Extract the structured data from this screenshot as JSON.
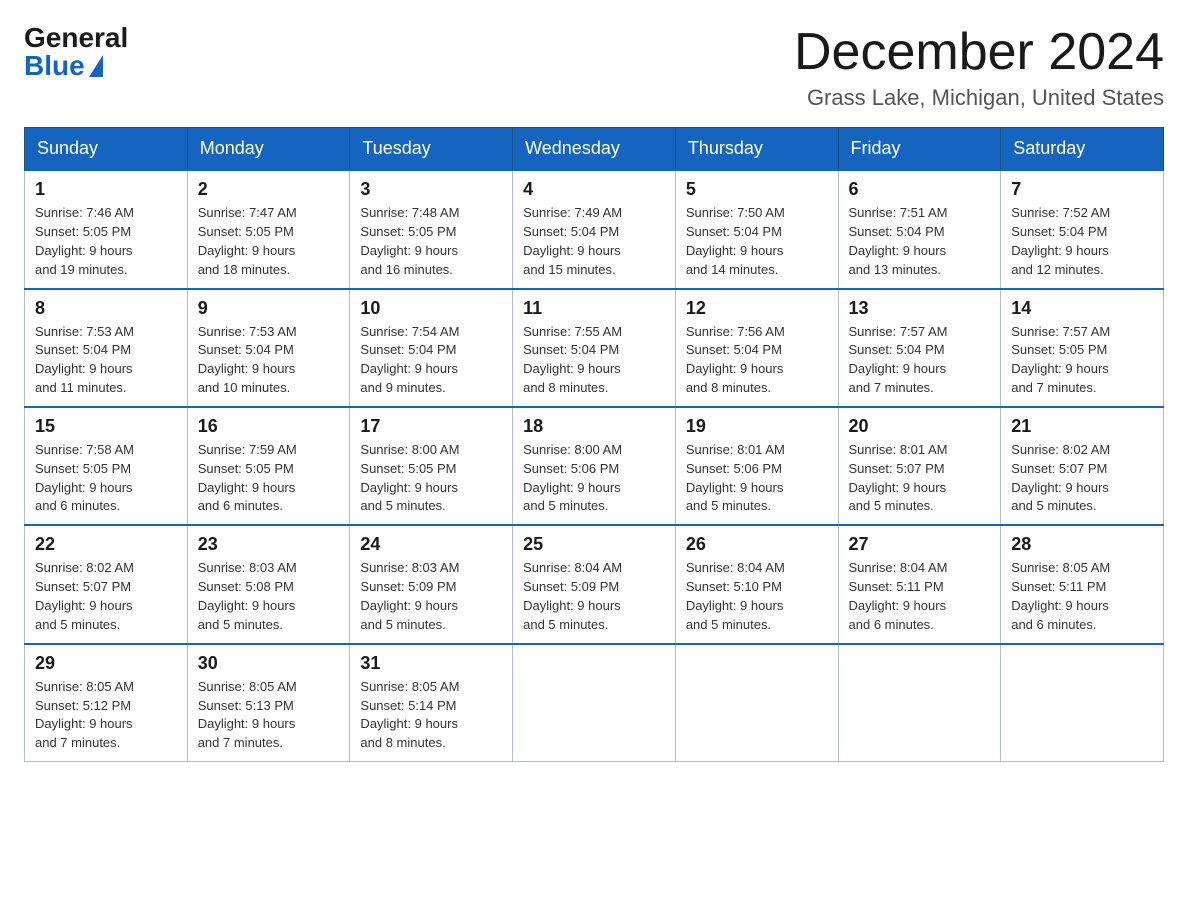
{
  "header": {
    "logo_general": "General",
    "logo_blue": "Blue",
    "month_title": "December 2024",
    "location": "Grass Lake, Michigan, United States"
  },
  "days_of_week": [
    "Sunday",
    "Monday",
    "Tuesday",
    "Wednesday",
    "Thursday",
    "Friday",
    "Saturday"
  ],
  "weeks": [
    [
      {
        "day": "1",
        "sunrise": "7:46 AM",
        "sunset": "5:05 PM",
        "daylight": "9 hours and 19 minutes."
      },
      {
        "day": "2",
        "sunrise": "7:47 AM",
        "sunset": "5:05 PM",
        "daylight": "9 hours and 18 minutes."
      },
      {
        "day": "3",
        "sunrise": "7:48 AM",
        "sunset": "5:05 PM",
        "daylight": "9 hours and 16 minutes."
      },
      {
        "day": "4",
        "sunrise": "7:49 AM",
        "sunset": "5:04 PM",
        "daylight": "9 hours and 15 minutes."
      },
      {
        "day": "5",
        "sunrise": "7:50 AM",
        "sunset": "5:04 PM",
        "daylight": "9 hours and 14 minutes."
      },
      {
        "day": "6",
        "sunrise": "7:51 AM",
        "sunset": "5:04 PM",
        "daylight": "9 hours and 13 minutes."
      },
      {
        "day": "7",
        "sunrise": "7:52 AM",
        "sunset": "5:04 PM",
        "daylight": "9 hours and 12 minutes."
      }
    ],
    [
      {
        "day": "8",
        "sunrise": "7:53 AM",
        "sunset": "5:04 PM",
        "daylight": "9 hours and 11 minutes."
      },
      {
        "day": "9",
        "sunrise": "7:53 AM",
        "sunset": "5:04 PM",
        "daylight": "9 hours and 10 minutes."
      },
      {
        "day": "10",
        "sunrise": "7:54 AM",
        "sunset": "5:04 PM",
        "daylight": "9 hours and 9 minutes."
      },
      {
        "day": "11",
        "sunrise": "7:55 AM",
        "sunset": "5:04 PM",
        "daylight": "9 hours and 8 minutes."
      },
      {
        "day": "12",
        "sunrise": "7:56 AM",
        "sunset": "5:04 PM",
        "daylight": "9 hours and 8 minutes."
      },
      {
        "day": "13",
        "sunrise": "7:57 AM",
        "sunset": "5:04 PM",
        "daylight": "9 hours and 7 minutes."
      },
      {
        "day": "14",
        "sunrise": "7:57 AM",
        "sunset": "5:05 PM",
        "daylight": "9 hours and 7 minutes."
      }
    ],
    [
      {
        "day": "15",
        "sunrise": "7:58 AM",
        "sunset": "5:05 PM",
        "daylight": "9 hours and 6 minutes."
      },
      {
        "day": "16",
        "sunrise": "7:59 AM",
        "sunset": "5:05 PM",
        "daylight": "9 hours and 6 minutes."
      },
      {
        "day": "17",
        "sunrise": "8:00 AM",
        "sunset": "5:05 PM",
        "daylight": "9 hours and 5 minutes."
      },
      {
        "day": "18",
        "sunrise": "8:00 AM",
        "sunset": "5:06 PM",
        "daylight": "9 hours and 5 minutes."
      },
      {
        "day": "19",
        "sunrise": "8:01 AM",
        "sunset": "5:06 PM",
        "daylight": "9 hours and 5 minutes."
      },
      {
        "day": "20",
        "sunrise": "8:01 AM",
        "sunset": "5:07 PM",
        "daylight": "9 hours and 5 minutes."
      },
      {
        "day": "21",
        "sunrise": "8:02 AM",
        "sunset": "5:07 PM",
        "daylight": "9 hours and 5 minutes."
      }
    ],
    [
      {
        "day": "22",
        "sunrise": "8:02 AM",
        "sunset": "5:07 PM",
        "daylight": "9 hours and 5 minutes."
      },
      {
        "day": "23",
        "sunrise": "8:03 AM",
        "sunset": "5:08 PM",
        "daylight": "9 hours and 5 minutes."
      },
      {
        "day": "24",
        "sunrise": "8:03 AM",
        "sunset": "5:09 PM",
        "daylight": "9 hours and 5 minutes."
      },
      {
        "day": "25",
        "sunrise": "8:04 AM",
        "sunset": "5:09 PM",
        "daylight": "9 hours and 5 minutes."
      },
      {
        "day": "26",
        "sunrise": "8:04 AM",
        "sunset": "5:10 PM",
        "daylight": "9 hours and 5 minutes."
      },
      {
        "day": "27",
        "sunrise": "8:04 AM",
        "sunset": "5:11 PM",
        "daylight": "9 hours and 6 minutes."
      },
      {
        "day": "28",
        "sunrise": "8:05 AM",
        "sunset": "5:11 PM",
        "daylight": "9 hours and 6 minutes."
      }
    ],
    [
      {
        "day": "29",
        "sunrise": "8:05 AM",
        "sunset": "5:12 PM",
        "daylight": "9 hours and 7 minutes."
      },
      {
        "day": "30",
        "sunrise": "8:05 AM",
        "sunset": "5:13 PM",
        "daylight": "9 hours and 7 minutes."
      },
      {
        "day": "31",
        "sunrise": "8:05 AM",
        "sunset": "5:14 PM",
        "daylight": "9 hours and 8 minutes."
      },
      null,
      null,
      null,
      null
    ]
  ]
}
